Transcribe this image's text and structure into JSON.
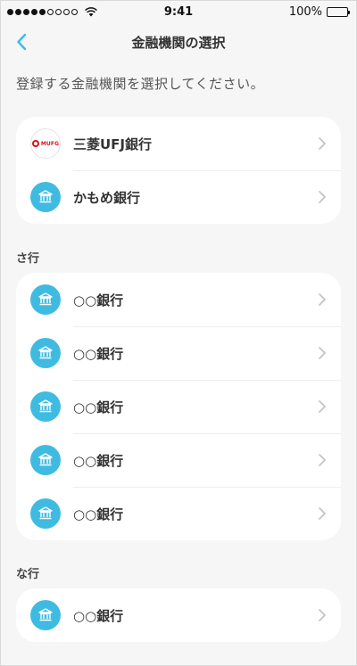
{
  "status_bar": {
    "time": "9:41",
    "battery": "100%",
    "battery_level": 1.0
  },
  "nav": {
    "title": "金融機関の選択",
    "back_icon": "chevron-left-icon"
  },
  "instruction": "登録する金融機関を選択してください。",
  "sections": [
    {
      "label": "",
      "items": [
        {
          "name": "三菱UFJ銀行",
          "icon": "mufg-logo",
          "logo_text": "MUFG"
        },
        {
          "name": "かもめ銀行",
          "icon": "bank-icon"
        }
      ]
    },
    {
      "label": "さ行",
      "items": [
        {
          "name": "○○銀行",
          "icon": "bank-icon"
        },
        {
          "name": "○○銀行",
          "icon": "bank-icon"
        },
        {
          "name": "○○銀行",
          "icon": "bank-icon"
        },
        {
          "name": "○○銀行",
          "icon": "bank-icon"
        },
        {
          "name": "○○銀行",
          "icon": "bank-icon"
        }
      ]
    },
    {
      "label": "な行",
      "items": [
        {
          "name": "○○銀行",
          "icon": "bank-icon"
        }
      ]
    }
  ],
  "colors": {
    "accent": "#3fbbe2",
    "background": "#f6f6f7",
    "card": "#ffffff",
    "mufg_red": "#d7141a"
  }
}
